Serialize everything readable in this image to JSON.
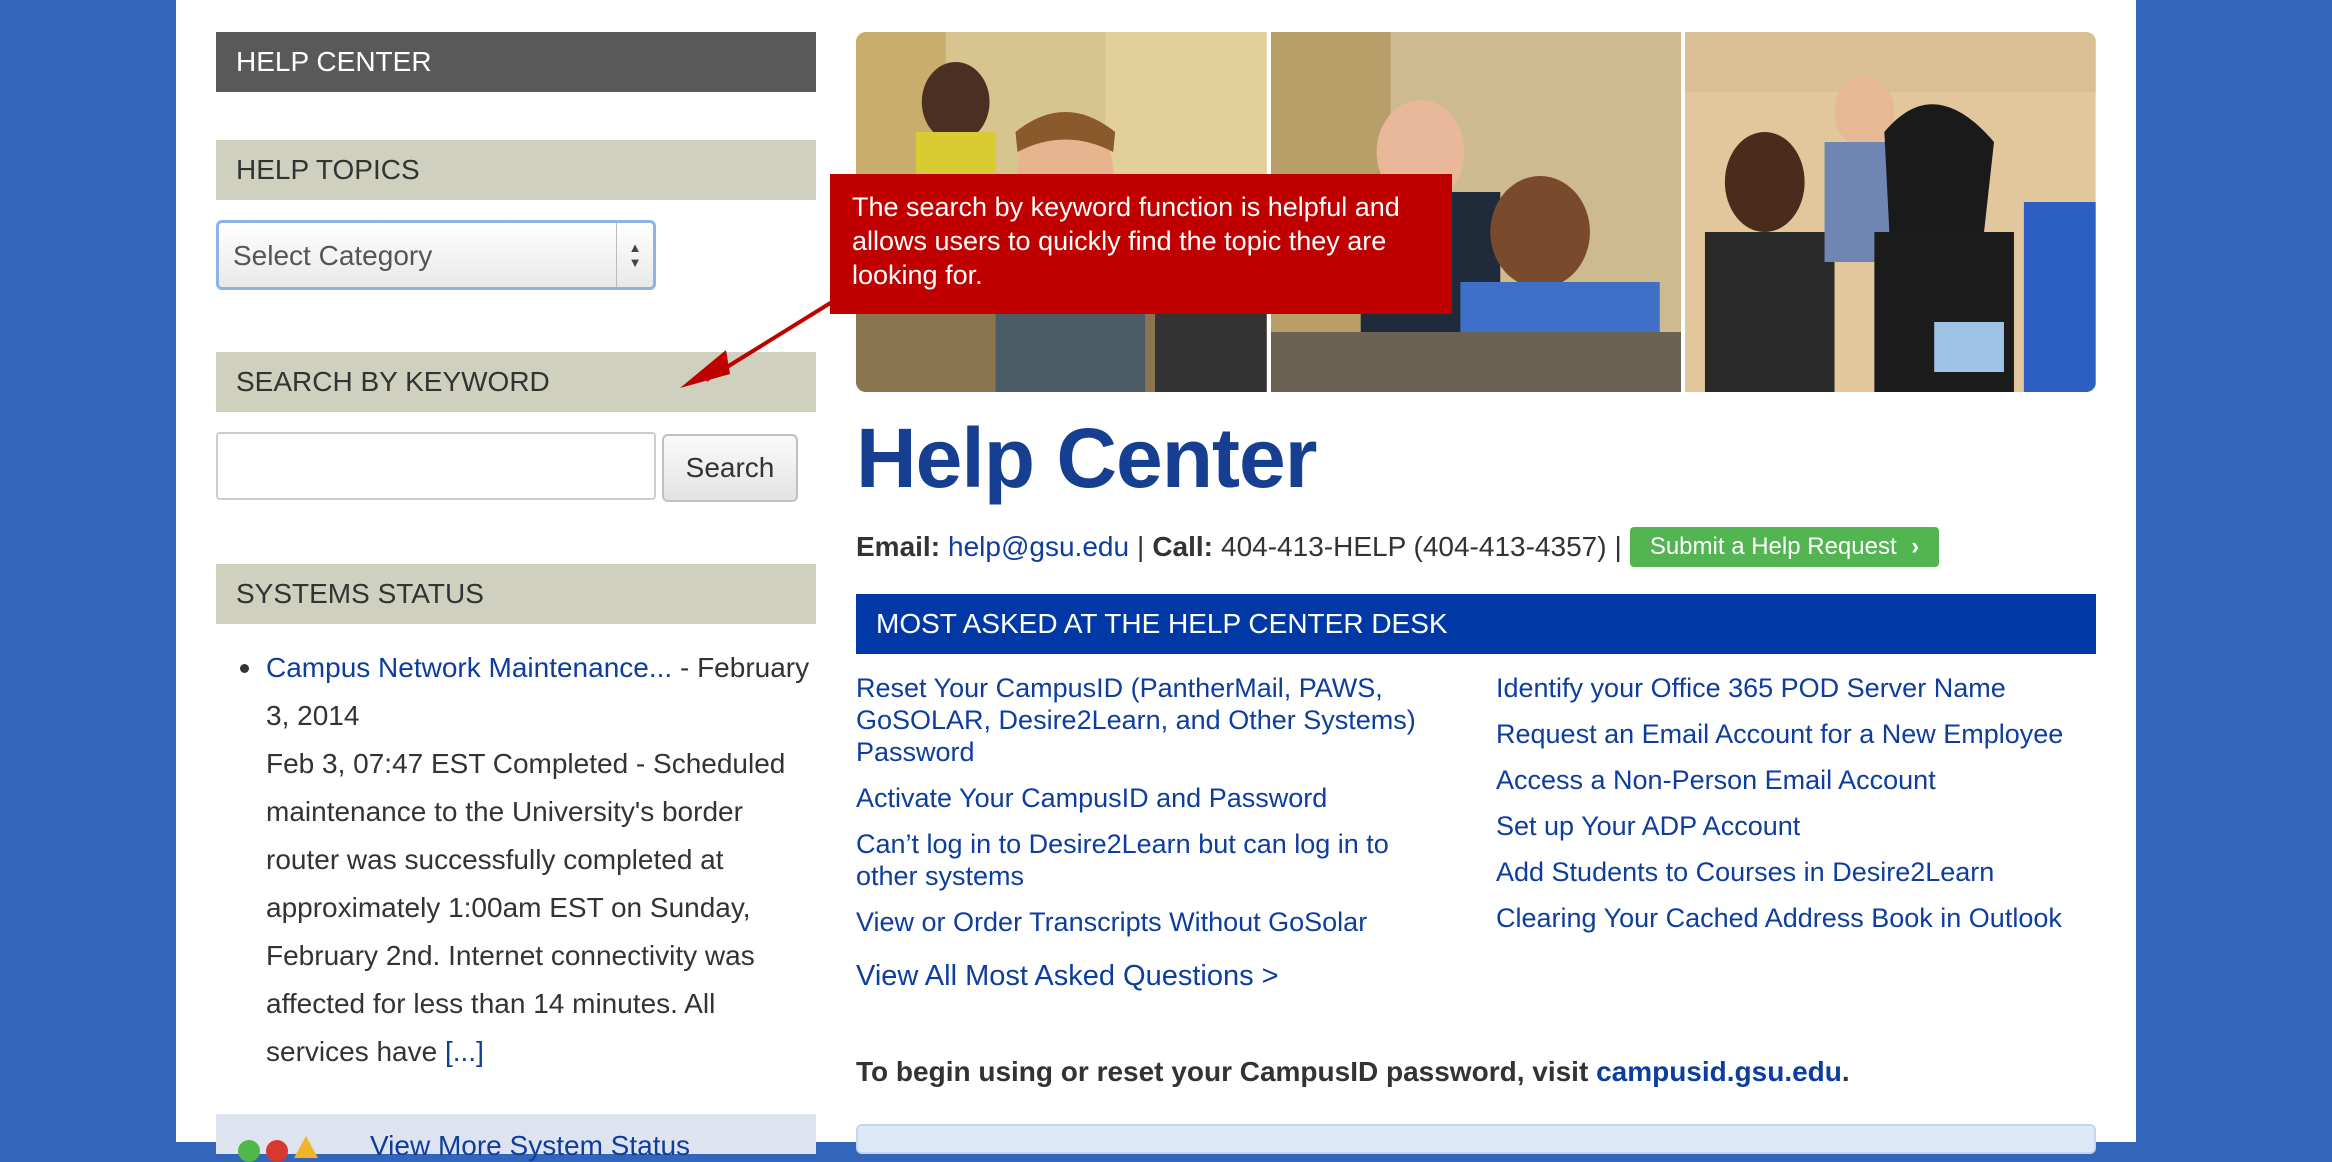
{
  "sidebar": {
    "help_center_header": "HELP CENTER",
    "help_topics_header": "HELP TOPICS",
    "category_select_value": "Select Category",
    "search_header": "SEARCH BY KEYWORD",
    "search_button_label": "Search",
    "search_input_value": "",
    "systems_status_header": "SYSTEMS STATUS",
    "status_item_link": "Campus Network Maintenance...",
    "status_item_date": " - February 3, 2014",
    "status_item_body": "Feb 3, 07:47 EST Completed - Scheduled maintenance to the University's border router was successfully completed at approximately 1:00am EST on Sunday, February 2nd. Internet connectivity was affected for less than 14 minutes. All services have ",
    "status_item_more": "[...]",
    "view_more_status_label": "View More System Status"
  },
  "callout_text": "The search by keyword function is helpful and allows users to quickly find the topic they are looking for.",
  "main": {
    "title": "Help Center",
    "email_label": "Email:",
    "email_value": "help@gsu.edu",
    "separator_1": "|",
    "call_label": "Call:",
    "call_value": "404-413-HELP (404-413-4357)",
    "separator_2": "|",
    "submit_button_label": "Submit a Help Request",
    "most_asked_header": "MOST ASKED AT THE HELP CENTER DESK",
    "left_links": [
      "Reset Your CampusID (PantherMail, PAWS, GoSOLAR, Desire2Learn, and Other Systems) Password",
      "Activate Your CampusID and Password",
      "Can’t log in to Desire2Learn but can log in to other systems",
      "View or Order Transcripts Without GoSolar"
    ],
    "right_links": [
      "Identify your Office 365 POD Server Name",
      "Request an Email Account for a New Employee",
      "Access a Non-Person Email Account",
      "Set up Your ADP Account",
      "Add Students to Courses in Desire2Learn",
      "Clearing Your Cached Address Book in Outlook"
    ],
    "view_all_label": "View All Most Asked Questions >",
    "campusid_text": "To begin using or reset your CampusID password, visit ",
    "campusid_link": "campusid.gsu.edu",
    "campusid_end": "."
  },
  "colors": {
    "page_background": "#3366bb",
    "dark_header": "#595959",
    "light_header": "#cfd0bd",
    "link": "#0d3d9e",
    "title": "#163f91",
    "callout": "#c00000",
    "most_asked_bar": "#0039a6",
    "submit_button": "#52b552"
  }
}
